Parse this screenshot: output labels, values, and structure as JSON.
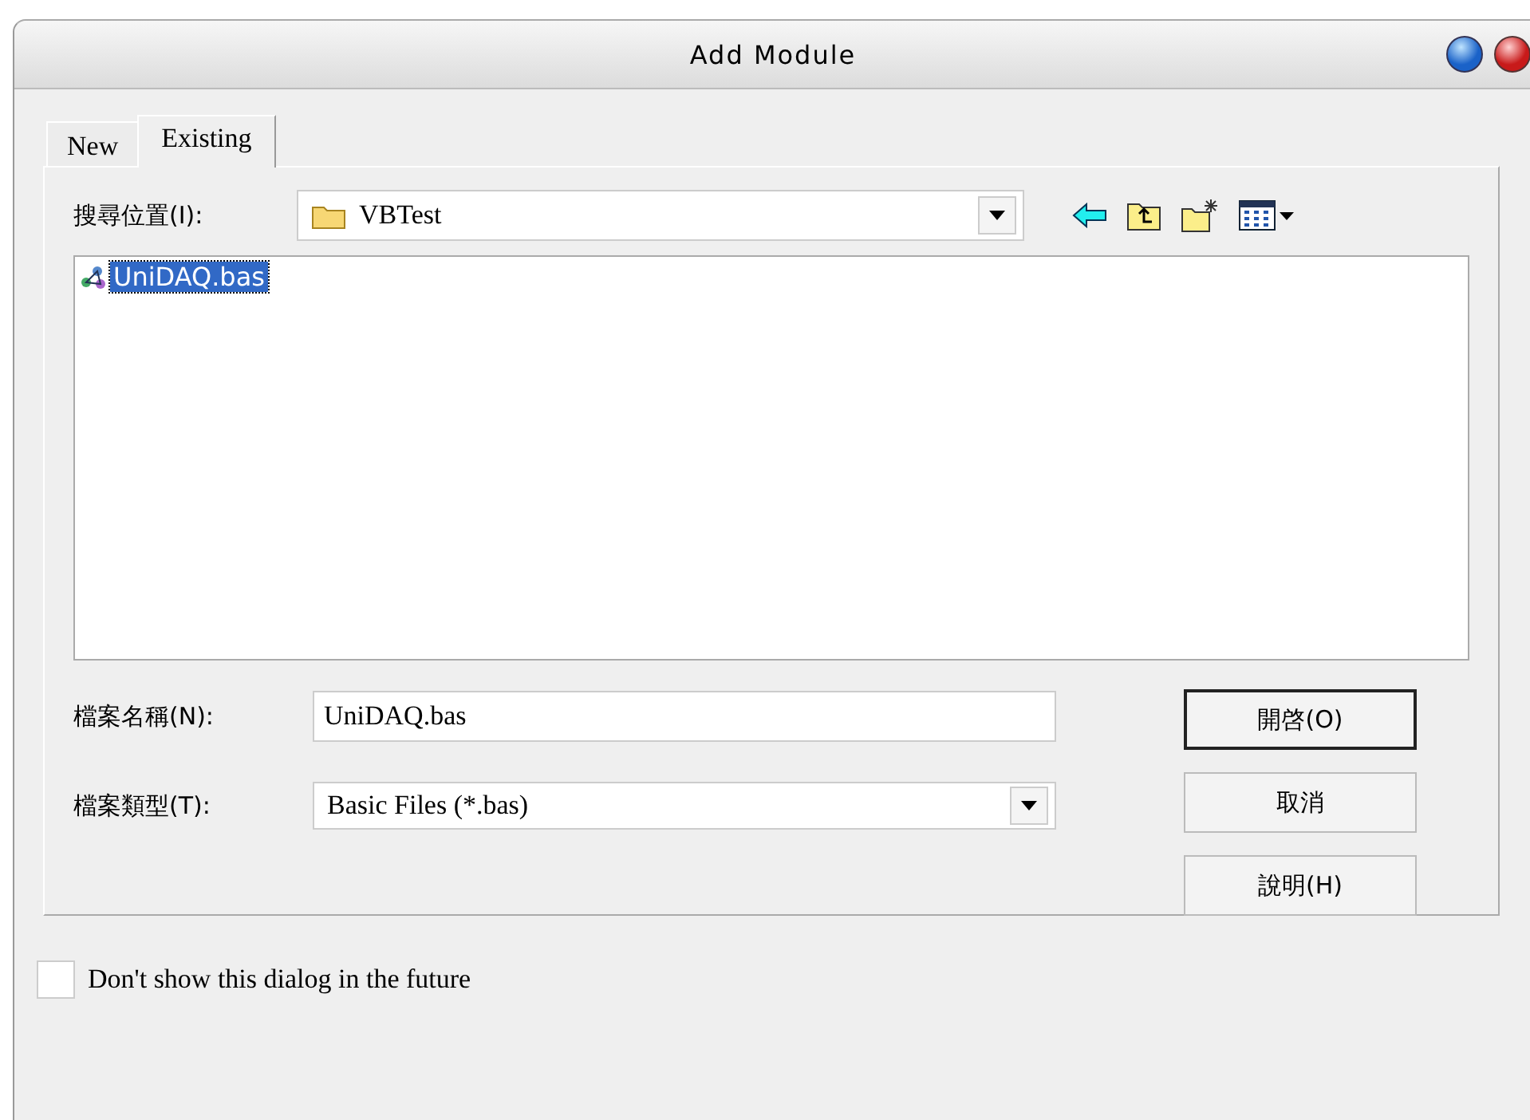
{
  "window": {
    "title": "Add Module"
  },
  "tabs": [
    {
      "label": "New",
      "selected": false
    },
    {
      "label": "Existing",
      "selected": true
    }
  ],
  "look_in": {
    "label": "搜尋位置(I):",
    "value": "VBTest"
  },
  "files": [
    {
      "name": "UniDAQ.bas",
      "selected": true
    }
  ],
  "file_name": {
    "label": "檔案名稱(N):",
    "value": "UniDAQ.bas"
  },
  "file_type": {
    "label": "檔案類型(T):",
    "value": "Basic Files (*.bas)"
  },
  "buttons": [
    {
      "label": "開啓(O)",
      "default": true
    },
    {
      "label": "取消",
      "default": false
    },
    {
      "label": "說明(H)",
      "default": false
    }
  ],
  "dont_show": {
    "label": "Don't show this dialog in the future",
    "checked": false
  }
}
